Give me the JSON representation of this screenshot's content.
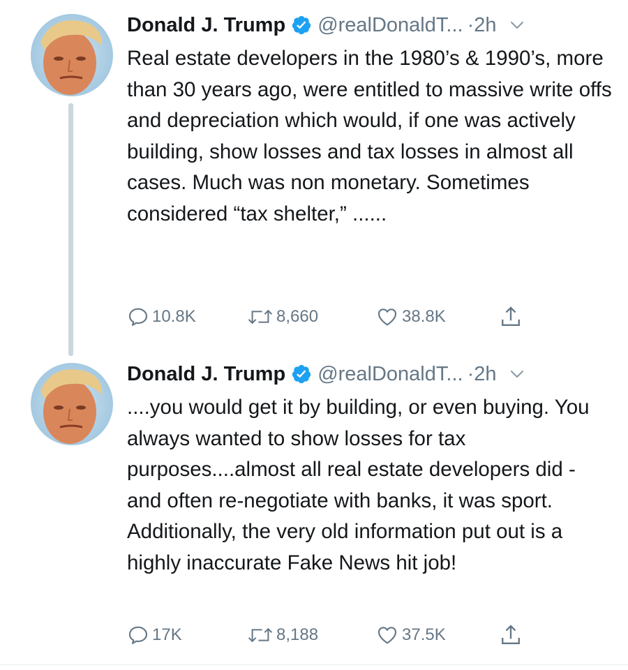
{
  "tweets": [
    {
      "author_name": "Donald J. Trump",
      "handle": "@realDonaldT...",
      "time": "2h",
      "text": "Real estate developers in the 1980’s & 1990’s, more than 30 years ago, were entitled to massive write offs and depreciation which would, if one was actively building, show losses and tax losses in almost all cases. Much was non monetary. Sometimes considered “tax shelter,” ......",
      "replies": "10.8K",
      "retweets": "8,660",
      "likes": "38.8K"
    },
    {
      "author_name": "Donald J. Trump",
      "handle": "@realDonaldT...",
      "time": "2h",
      "text": "....you would get it by building, or even buying. You always wanted to show losses for tax purposes....almost all real estate developers did - and often re-negotiate with banks, it was sport. Additionally, the very old information put out is a highly inaccurate Fake News hit job!",
      "replies": "17K",
      "retweets": "8,188",
      "likes": "37.5K"
    }
  ],
  "colors": {
    "verified": "#1da1f2",
    "secondary_text": "#657786",
    "thread_line": "#ccd6dd"
  },
  "icons": [
    "verified-badge-icon",
    "chevron-down-icon",
    "reply-icon",
    "retweet-icon",
    "like-icon",
    "share-icon"
  ]
}
